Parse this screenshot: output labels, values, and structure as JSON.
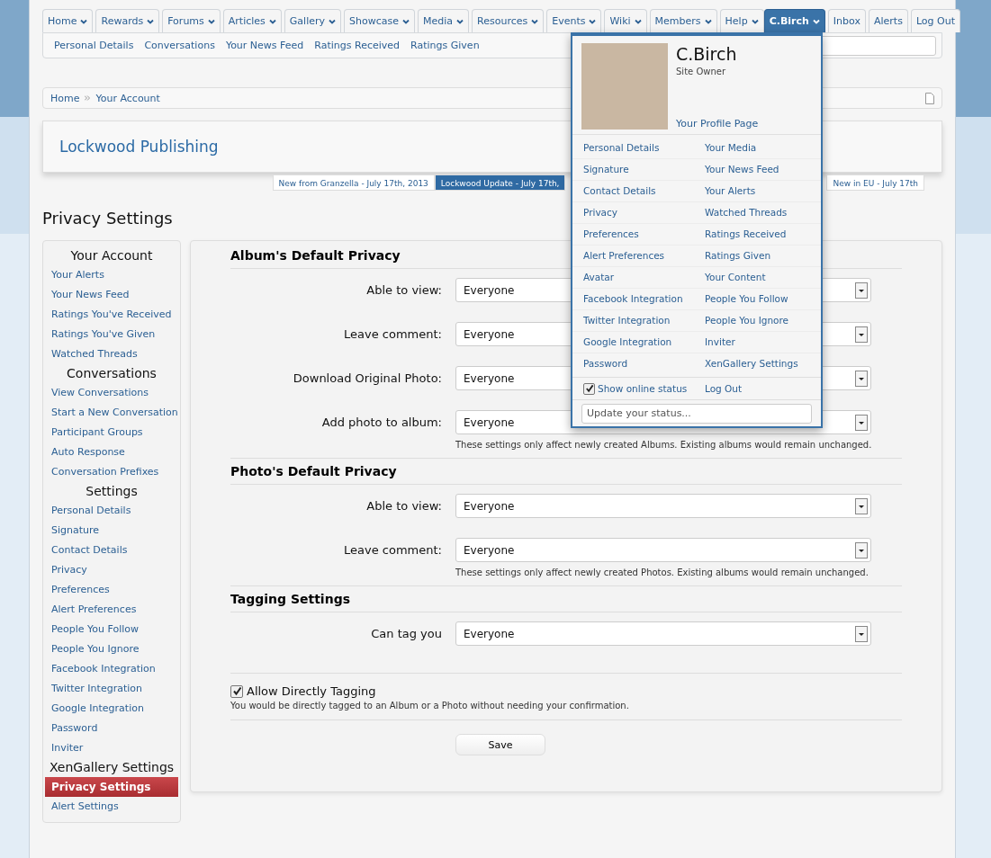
{
  "nav": {
    "tabs": [
      {
        "label": "Home",
        "has_menu": true,
        "selected": false
      },
      {
        "label": "Rewards",
        "has_menu": true,
        "selected": false
      },
      {
        "label": "Forums",
        "has_menu": true,
        "selected": false
      },
      {
        "label": "Articles",
        "has_menu": true,
        "selected": false
      },
      {
        "label": "Gallery",
        "has_menu": true,
        "selected": false
      },
      {
        "label": "Showcase",
        "has_menu": true,
        "selected": false
      },
      {
        "label": "Media",
        "has_menu": true,
        "selected": false
      },
      {
        "label": "Resources",
        "has_menu": true,
        "selected": false
      },
      {
        "label": "Events",
        "has_menu": true,
        "selected": false
      },
      {
        "label": "Wiki",
        "has_menu": true,
        "selected": false
      },
      {
        "label": "Members",
        "has_menu": true,
        "selected": false
      },
      {
        "label": "Help",
        "has_menu": true,
        "selected": false
      }
    ],
    "account_tabs": [
      {
        "label": "C.Birch",
        "has_menu": true,
        "selected": true
      },
      {
        "label": "Inbox",
        "has_menu": false,
        "selected": false
      },
      {
        "label": "Alerts",
        "has_menu": false,
        "selected": false
      },
      {
        "label": "Log Out",
        "has_menu": false,
        "selected": false
      }
    ],
    "sub_links": [
      "Personal Details",
      "Conversations",
      "Your News Feed",
      "Ratings Received",
      "Ratings Given"
    ]
  },
  "breadcrumb": [
    "Home",
    "Your Account"
  ],
  "header": {
    "title": "Lockwood Publishing"
  },
  "ticker": [
    {
      "label": "New from Granzella - July 17th, 2013",
      "selected": false
    },
    {
      "label": "Lockwood Update - July 17th,",
      "selected": true
    },
    {
      "label": "New in EU - July 17th",
      "selected": false
    }
  ],
  "page_title": "Privacy Settings",
  "sidebar": {
    "sections": [
      {
        "heading": "Your Account",
        "items": [
          {
            "label": "Your Alerts",
            "selected": false
          },
          {
            "label": "Your News Feed",
            "selected": false
          },
          {
            "label": "Ratings You've Received",
            "selected": false
          },
          {
            "label": "Ratings You've Given",
            "selected": false
          },
          {
            "label": "Watched Threads",
            "selected": false
          }
        ]
      },
      {
        "heading": "Conversations",
        "items": [
          {
            "label": "View Conversations",
            "selected": false
          },
          {
            "label": "Start a New Conversation",
            "selected": false
          },
          {
            "label": "Participant Groups",
            "selected": false
          },
          {
            "label": "Auto Response",
            "selected": false
          },
          {
            "label": "Conversation Prefixes",
            "selected": false
          }
        ]
      },
      {
        "heading": "Settings",
        "items": [
          {
            "label": "Personal Details",
            "selected": false
          },
          {
            "label": "Signature",
            "selected": false
          },
          {
            "label": "Contact Details",
            "selected": false
          },
          {
            "label": "Privacy",
            "selected": false
          },
          {
            "label": "Preferences",
            "selected": false
          },
          {
            "label": "Alert Preferences",
            "selected": false
          },
          {
            "label": "People You Follow",
            "selected": false
          },
          {
            "label": "People You Ignore",
            "selected": false
          },
          {
            "label": "Facebook Integration",
            "selected": false
          },
          {
            "label": "Twitter Integration",
            "selected": false
          },
          {
            "label": "Google Integration",
            "selected": false
          },
          {
            "label": "Password",
            "selected": false
          },
          {
            "label": "Inviter",
            "selected": false
          }
        ]
      },
      {
        "heading": "XenGallery Settings",
        "items": [
          {
            "label": "Privacy Settings",
            "selected": true
          },
          {
            "label": "Alert Settings",
            "selected": false
          }
        ]
      }
    ]
  },
  "form": {
    "sections": [
      {
        "heading": "Album's Default Privacy",
        "rows": [
          {
            "label": "Able to view:",
            "value": "Everyone"
          },
          {
            "label": "Leave comment:",
            "value": "Everyone"
          },
          {
            "label": "Download Original Photo:",
            "value": "Everyone"
          },
          {
            "label": "Add photo to album:",
            "value": "Everyone"
          }
        ],
        "hint": "These settings only affect newly created Albums. Existing albums would remain unchanged."
      },
      {
        "heading": "Photo's Default Privacy",
        "rows": [
          {
            "label": "Able to view:",
            "value": "Everyone"
          },
          {
            "label": "Leave comment:",
            "value": "Everyone"
          }
        ],
        "hint": "These settings only affect newly created Photos. Existing albums would remain unchanged."
      },
      {
        "heading": "Tagging Settings",
        "rows": [
          {
            "label": "Can tag you",
            "value": "Everyone"
          }
        ]
      }
    ],
    "checkbox": {
      "label": "Allow Directly Tagging",
      "checked": true,
      "hint": "You would be directly tagged to an Album or a Photo without needing your confirmation."
    },
    "save": "Save"
  },
  "account_menu": {
    "name": "C.Birch",
    "role": "Site Owner",
    "profile_link": "Your Profile Page",
    "rows": [
      [
        "Personal Details",
        "Your Media"
      ],
      [
        "Signature",
        "Your News Feed"
      ],
      [
        "Contact Details",
        "Your Alerts"
      ],
      [
        "Privacy",
        "Watched Threads"
      ],
      [
        "Preferences",
        "Ratings Received"
      ],
      [
        "Alert Preferences",
        "Ratings Given"
      ],
      [
        "Avatar",
        "Your Content"
      ],
      [
        "Facebook Integration",
        "People You Follow"
      ],
      [
        "Twitter Integration",
        "People You Ignore"
      ],
      [
        "Google Integration",
        "Inviter"
      ],
      [
        "Password",
        "XenGallery Settings"
      ]
    ],
    "online_status": {
      "label": "Show online status",
      "checked": true
    },
    "logout": "Log Out",
    "status_placeholder": "Update your status..."
  }
}
